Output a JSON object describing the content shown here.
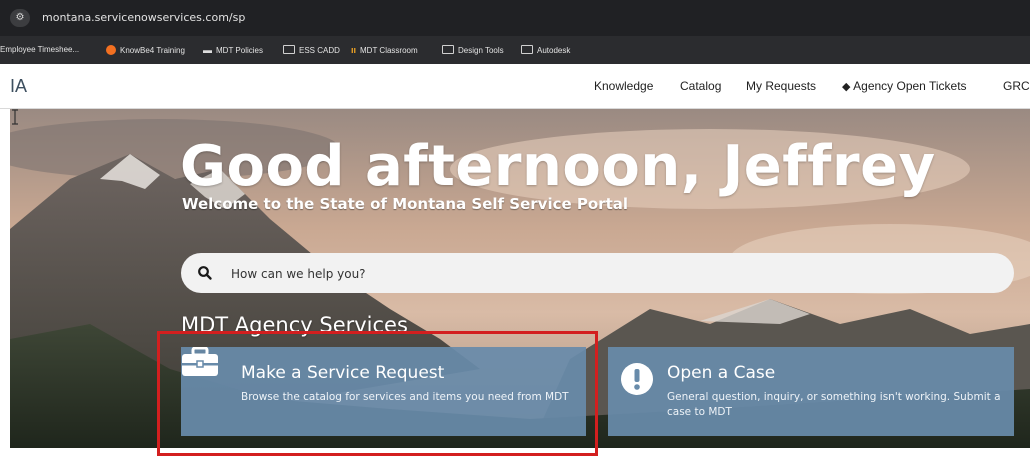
{
  "browser": {
    "url": "montana.servicenowservices.com/sp",
    "site_icon": "site-settings-icon",
    "bookmarks": [
      {
        "label": "Employee Timeshee...",
        "icon": "none"
      },
      {
        "label": "KnowBe4 Training",
        "icon": "knowbe4-icon"
      },
      {
        "label": "MDT Policies",
        "icon": "policies-icon"
      },
      {
        "label": "ESS CADD",
        "icon": "folder-icon"
      },
      {
        "label": "MDT Classroom",
        "icon": "classroom-icon"
      },
      {
        "label": "Design Tools",
        "icon": "folder-icon"
      },
      {
        "label": "Autodesk",
        "icon": "folder-icon"
      }
    ]
  },
  "header": {
    "brand": "IA",
    "nav": [
      "Knowledge",
      "Catalog",
      "My Requests",
      "Agency Open Tickets",
      "GRC"
    ],
    "agency_icon": "tag-icon"
  },
  "hero": {
    "greeting": "Good afternoon, Jeffrey",
    "welcome": "Welcome to the State of Montana Self Service Portal",
    "search_placeholder": "How can we help you?"
  },
  "services": {
    "title": "MDT Agency Services",
    "cards": [
      {
        "title": "Make a Service Request",
        "description": "Browse the catalog for services and items you need from MDT",
        "icon": "briefcase-icon"
      },
      {
        "title": "Open a Case",
        "description": "General question, inquiry, or something isn't working. Submit a case to MDT",
        "icon": "exclamation-icon"
      }
    ]
  },
  "colors": {
    "highlight": "#d31f1f",
    "card": "#688baa"
  }
}
